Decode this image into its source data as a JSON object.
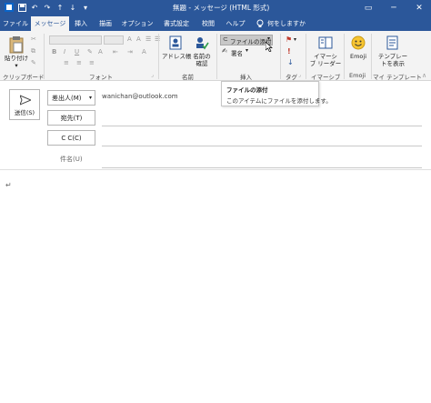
{
  "title_bar": {
    "title": "無題 - メッセージ (HTML 形式)",
    "minimize_glyph": "─",
    "restore_glyph": "⧉",
    "maximize_glyph": "□",
    "close_glyph": "✕"
  },
  "menu": {
    "tabs": [
      "ファイル",
      "メッセージ",
      "挿入",
      "描画",
      "オプション",
      "書式設定",
      "校閲",
      "ヘルプ"
    ],
    "tell_me": "何をしますか"
  },
  "ribbon": {
    "clipboard": {
      "paste_label": "貼り付け",
      "group_label": "クリップボード"
    },
    "font": {
      "group_label": "フォント",
      "bold": "B",
      "italic": "I",
      "underline": "U",
      "align_left": "≡",
      "align_center": "≡",
      "align_right": "≡"
    },
    "names": {
      "address_book": "アドレス帳",
      "check_names": "名前の\n確認",
      "group_label": "名前"
    },
    "insert": {
      "attach_file": "ファイルの添付",
      "signature": "署名",
      "group_label": "挿入"
    },
    "tags": {
      "group_label": "タグ"
    },
    "immersive": {
      "button_label": "イマーシ\nブ リーダー",
      "group_label": "イマーシブ"
    },
    "emoji": {
      "button_label": "Emoji",
      "group_label": "Emoji"
    },
    "templates": {
      "button_label": "テンプレー\nトを表示",
      "group_label": "マイ テンプレート"
    }
  },
  "tooltip": {
    "title": "ファイルの添付",
    "description": "このアイテムにファイルを添付します。"
  },
  "compose": {
    "send_label": "送信(S)",
    "from_label": "差出人(M)",
    "from_value": "wanichan@outlook.com",
    "to_label": "宛先(T)",
    "cc_label": "C C(C)",
    "subject_label": "件名(U)"
  },
  "body": {
    "paragraph_mark": "↵"
  },
  "colors": {
    "accent": "#2b579a",
    "ribbon_bg": "#f3f3f3"
  }
}
